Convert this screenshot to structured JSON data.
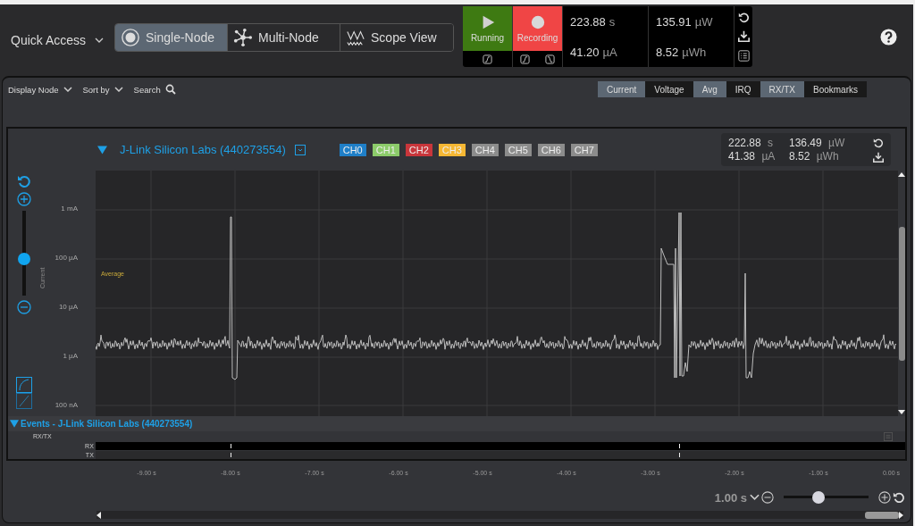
{
  "top_bar": {
    "quick_access": "Quick Access",
    "views": [
      {
        "label": "Single-Node",
        "kind": "single",
        "selected": true
      },
      {
        "label": "Multi-Node",
        "kind": "multi",
        "selected": false
      },
      {
        "label": "Scope View",
        "kind": "scope",
        "selected": false
      }
    ]
  },
  "status": {
    "running": "Running",
    "recording": "Recording",
    "readings": [
      {
        "value": "223.88",
        "unit": "s"
      },
      {
        "value": "135.91",
        "unit": "µW"
      },
      {
        "value": "41.20",
        "unit": "µA"
      },
      {
        "value": "8.52",
        "unit": "µWh"
      }
    ]
  },
  "toolbar": {
    "filters": [
      "Display Node",
      "Sort by"
    ],
    "search": "Search",
    "toggles": [
      {
        "label": "Current",
        "on": true
      },
      {
        "label": "Voltage",
        "on": false
      },
      {
        "label": "Avg",
        "on": true
      },
      {
        "label": "IRQ",
        "on": false
      },
      {
        "label": "RX/TX",
        "on": true
      },
      {
        "label": "Bookmarks",
        "on": false
      }
    ]
  },
  "chart": {
    "title": "J-Link Silicon Labs (440273554)",
    "channels": [
      {
        "label": "CH0",
        "color": "#1f7fc8"
      },
      {
        "label": "CH1",
        "color": "#8ccb6a"
      },
      {
        "label": "CH2",
        "color": "#c9363b"
      },
      {
        "label": "CH3",
        "color": "#f6b733"
      },
      {
        "label": "CH4",
        "color": "#8c8c8c"
      },
      {
        "label": "CH5",
        "color": "#8c8c8c"
      },
      {
        "label": "CH6",
        "color": "#8c8c8c"
      },
      {
        "label": "CH7",
        "color": "#8c8c8c"
      }
    ],
    "readings": [
      {
        "value": "222.88",
        "unit": "s"
      },
      {
        "value": "136.49",
        "unit": "µW"
      },
      {
        "value": "41.38",
        "unit": "µA"
      },
      {
        "value": "8.52",
        "unit": "µWh"
      }
    ],
    "y_axis_label": "Current",
    "y_ticks": [
      "1 mA",
      "100 µA",
      "10 µA",
      "1 µA",
      "100 nA"
    ],
    "average_label": "Average",
    "zoom": {
      "level": 0.43
    },
    "events_title": "Events - J-Link Silicon Labs (440273554)",
    "events_group": "RX/TX",
    "event_rows": [
      "RX",
      "TX"
    ],
    "x_ticks": [
      "-9.00 s",
      "-8.00 s",
      "-7.00 s",
      "-6.00 s",
      "-5.00 s",
      "-4.00 s",
      "-3.00 s",
      "-2.00 s",
      "-1.00 s",
      "0.00 s"
    ]
  },
  "timebase": {
    "value": "1.00 s",
    "level": 0.41
  }
}
